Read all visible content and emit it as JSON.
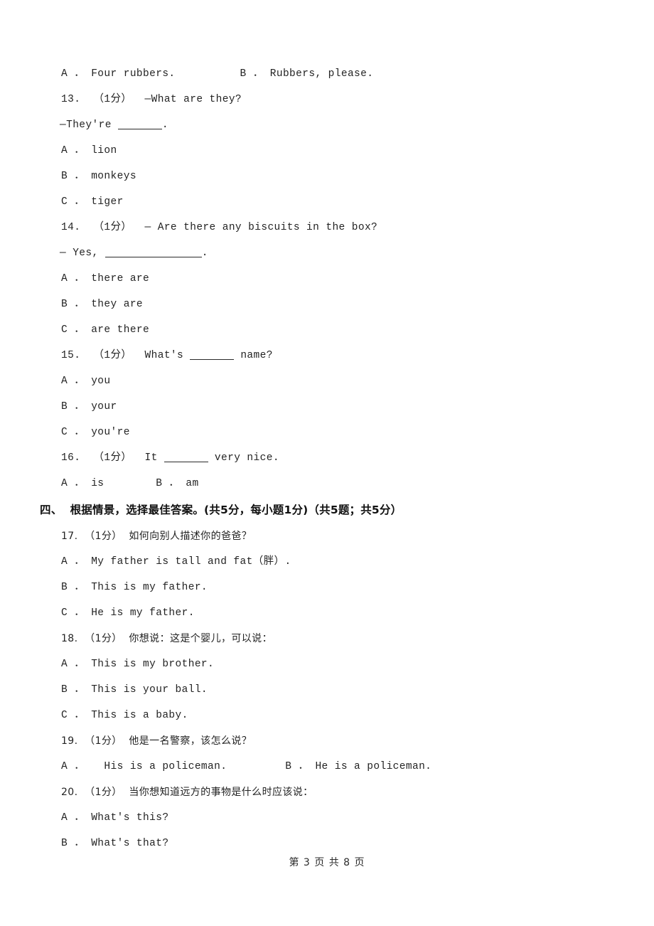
{
  "page": {
    "footer": "第 3 页 共 8 页",
    "page_number": "3",
    "total_pages": "8"
  },
  "top_options": {
    "row": "A ． Four rubbers.          B ． Rubbers, please."
  },
  "questions": [
    {
      "number": "13.",
      "marks": "（1分）",
      "stem": "13.  （1分）  —What are they?",
      "stem_continued": "—They're ",
      "stem_continued_tail": ".",
      "options": [
        "A ． lion",
        "B ． monkeys",
        "C ． tiger"
      ]
    },
    {
      "number": "14.",
      "marks": "（1分）",
      "stem": "14.  （1分）  — Are there any biscuits in the box?",
      "stem_continued": "— Yes, ",
      "stem_continued_tail": ".",
      "options": [
        "A ． there are",
        "B ． they are",
        "C ． are there"
      ]
    },
    {
      "number": "15.",
      "marks": "（1分）",
      "stem_pre": "15.  （1分）  What's ",
      "stem_post": " name?",
      "options": [
        "A ． you",
        "B ． your",
        "C ． you're"
      ]
    },
    {
      "number": "16.",
      "marks": "（1分）",
      "stem_pre": "16.  （1分）  It ",
      "stem_post": " very nice.",
      "options_row": "A ． is        B ． am"
    }
  ],
  "section": {
    "label": "四、",
    "heading": "四、  根据情景，选择最佳答案。(共5分，每小题1分)（共5题；共5分）",
    "questions": [
      {
        "number": "17.",
        "marks": "（1分）",
        "stem": "17.  （1分）  如何向别人描述你的爸爸？",
        "options": [
          "A ． My father is tall and fat（胖）.",
          "B ． This is my father.",
          "C ． He is my father."
        ]
      },
      {
        "number": "18.",
        "marks": "（1分）",
        "stem": "18.  （1分）  你想说：这是个婴儿，可以说：",
        "options": [
          "A ． This is my brother.",
          "B ． This is your ball.",
          "C ． This is a baby."
        ]
      },
      {
        "number": "19.",
        "marks": "（1分）",
        "stem": "19.  （1分）  他是一名警察，该怎么说？",
        "options_row": "A ．   His is a policeman.         B ． He is a policeman."
      },
      {
        "number": "20.",
        "marks": "（1分）",
        "stem": "20.  （1分）  当你想知道远方的事物是什么时应该说：",
        "options": [
          "A ． What's this?",
          "B ． What's that?"
        ]
      }
    ]
  }
}
